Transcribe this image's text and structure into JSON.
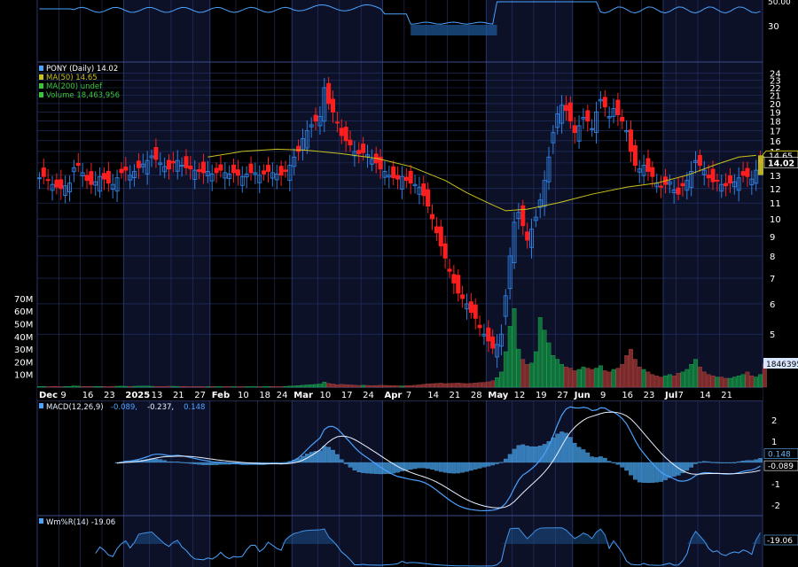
{
  "colors": {
    "background": "#000000",
    "month_band": "#0c1128",
    "grid": "#25356a",
    "up_candle": "#2f7fe0",
    "down_candle": "#ff1e1e",
    "ma50": "#c9c21e",
    "volume_up": "#11703a",
    "volume_down": "#7a2a2a",
    "macd_line": "#4aa3ff",
    "signal_line": "#e8f0ff",
    "histogram": "#3a8fd0",
    "willr_line": "#4aa3ff",
    "axis_text": "#ffffff",
    "label_price_box": "#c9c21e"
  },
  "chart_data": [
    {
      "panel": "rsi_top",
      "type": "line",
      "title": "",
      "y_ticks": [
        "30"
      ],
      "top_partial_label": "50.00",
      "ylim": [
        25,
        55
      ]
    },
    {
      "panel": "price",
      "type": "candlestick",
      "scale": "log",
      "legend": [
        {
          "label": "PONY (Daily) 14.02",
          "color": "#4aa3ff",
          "icon": "candle-icon"
        },
        {
          "label": "MA(50) 14.65",
          "color": "#c9c21e",
          "icon": "line-icon"
        },
        {
          "label": "MA(200) undef",
          "color": "#3ac43a",
          "icon": "line-icon"
        },
        {
          "label": "Volume 18,463,956",
          "color": "#3ac43a",
          "icon": "bar-icon"
        }
      ],
      "y_ticks": [
        "24",
        "23",
        "22",
        "21",
        "20",
        "19",
        "18",
        "17",
        "16",
        "15",
        "14",
        "13",
        "12",
        "11",
        "10",
        "9",
        "8",
        "7",
        "6",
        "5"
      ],
      "ylim": [
        4.5,
        25
      ],
      "last_close": "14.02",
      "ma50_value": "14.65",
      "ma50_points": [
        [
          39,
          14.5
        ],
        [
          47,
          15.0
        ],
        [
          55,
          15.2
        ],
        [
          62,
          15.1
        ],
        [
          70,
          14.8
        ],
        [
          78,
          14.4
        ],
        [
          86,
          13.7
        ],
        [
          94,
          12.6
        ],
        [
          99,
          11.7
        ],
        [
          104,
          11.0
        ],
        [
          108,
          10.5
        ],
        [
          113,
          10.6
        ],
        [
          120,
          11.0
        ],
        [
          128,
          11.6
        ],
        [
          136,
          12.1
        ],
        [
          143,
          12.4
        ],
        [
          150,
          13.0
        ],
        [
          157,
          13.9
        ],
        [
          162,
          14.5
        ],
        [
          166,
          14.65
        ]
      ],
      "price_closes": [
        12.8,
        12.9,
        12.6,
        12.3,
        12.1,
        12.0,
        12.2,
        12.4,
        13.6,
        13.8,
        13.2,
        12.6,
        12.3,
        12.5,
        12.9,
        12.7,
        12.4,
        12.3,
        12.8,
        13.2,
        13.4,
        13.0,
        13.3,
        13.6,
        13.9,
        14.2,
        14.6,
        14.3,
        14.0,
        13.7,
        13.5,
        14.0,
        14.2,
        13.8,
        13.6,
        13.5,
        13.4,
        13.3,
        13.2,
        13.3,
        13.1,
        13.2,
        13.4,
        13.2,
        13.1,
        13.2,
        13.0,
        12.9,
        13.1,
        13.2,
        13.2,
        13.0,
        13.1,
        13.3,
        13.2,
        13.1,
        13.0,
        13.3,
        13.8,
        14.5,
        15.0,
        16.2,
        17.0,
        17.6,
        18.0,
        18.5,
        22.0,
        20.0,
        19.0,
        17.8,
        16.5,
        16.0,
        15.6,
        15.0,
        14.8,
        14.9,
        14.7,
        14.3,
        14.0,
        13.5,
        13.3,
        13.0,
        12.8,
        12.7,
        12.9,
        12.6,
        12.4,
        12.3,
        12.1,
        11.5,
        10.8,
        10.0,
        9.2,
        8.5,
        7.9,
        7.3,
        6.8,
        6.4,
        6.2,
        6.0,
        5.7,
        5.5,
        5.2,
        5.0,
        4.8,
        4.6,
        4.7,
        5.0,
        6.3,
        8.0,
        9.8,
        10.4,
        9.6,
        8.8,
        9.4,
        10.1,
        11.2,
        12.6,
        14.5,
        16.8,
        18.8,
        19.8,
        19.2,
        18.0,
        16.8,
        17.5,
        18.4,
        18.0,
        17.2,
        19.0,
        20.5,
        19.6,
        18.5,
        19.4,
        18.7,
        18.0,
        17.0,
        15.0,
        13.8,
        13.5,
        13.8,
        13.3,
        12.9,
        12.4,
        12.1,
        12.3,
        12.5,
        11.9,
        11.6,
        12.2,
        12.6,
        13.3,
        14.2,
        13.8,
        13.4,
        12.8,
        12.5,
        12.6,
        12.3,
        12.2,
        12.4,
        12.5,
        12.8,
        13.0,
        12.9,
        12.7,
        13.4,
        14.02
      ]
    },
    {
      "panel": "volume",
      "type": "bar",
      "y_ticks": [
        "70M",
        "60M",
        "50M",
        "40M",
        "30M",
        "20M",
        "10M"
      ],
      "last_volume_label": "1846395",
      "volumes_m": [
        0.5,
        0.6,
        0.4,
        0.5,
        0.6,
        0.4,
        0.5,
        0.6,
        1.0,
        0.8,
        0.6,
        0.5,
        0.5,
        0.6,
        0.5,
        0.5,
        0.4,
        0.6,
        0.7,
        0.8,
        0.7,
        0.6,
        0.7,
        0.8,
        0.8,
        0.9,
        0.7,
        0.6,
        0.6,
        0.5,
        0.7,
        0.7,
        0.6,
        0.5,
        0.5,
        0.4,
        0.5,
        0.5,
        0.4,
        0.4,
        0.5,
        0.4,
        0.4,
        0.4,
        0.4,
        0.4,
        0.4,
        0.4,
        0.4,
        0.4,
        0.4,
        0.4,
        0.4,
        0.5,
        0.5,
        0.4,
        0.4,
        0.5,
        0.8,
        1.0,
        1.2,
        1.5,
        1.8,
        2.0,
        2.2,
        2.5,
        4.0,
        3.0,
        2.5,
        2.0,
        2.2,
        2.0,
        1.8,
        1.5,
        1.4,
        1.5,
        1.4,
        1.2,
        1.3,
        1.5,
        1.4,
        1.3,
        1.2,
        1.1,
        1.0,
        1.2,
        1.3,
        1.5,
        1.8,
        2.2,
        2.6,
        2.8,
        3.0,
        3.2,
        2.8,
        3.0,
        3.1,
        3.3,
        3.0,
        2.8,
        3.0,
        3.3,
        3.6,
        3.8,
        4.2,
        5.0,
        7.5,
        12.0,
        28.0,
        48.0,
        62.0,
        30.0,
        22.0,
        18.0,
        19.0,
        28.0,
        55.0,
        45.0,
        35.0,
        25.0,
        22.0,
        18.0,
        16.0,
        15.0,
        13.0,
        14.0,
        16.0,
        15.0,
        14.0,
        15.0,
        17.0,
        13.0,
        12.0,
        14.0,
        15.0,
        18.0,
        25.0,
        30.0,
        22.0,
        16.0,
        14.0,
        12.0,
        10.0,
        9.0,
        8.0,
        9.0,
        10.0,
        9.0,
        11.0,
        12.0,
        14.0,
        18.0,
        22.0,
        16.0,
        12.0,
        10.0,
        9.0,
        8.0,
        8.0,
        7.0,
        7.0,
        8.0,
        9.0,
        10.0,
        12.0,
        9.0,
        8.0,
        10.0,
        18.46
      ]
    },
    {
      "panel": "macd",
      "type": "line",
      "legend": [
        {
          "label": "MACD(12,26,9)",
          "color": "#e8f0ff"
        },
        {
          "label": "-0.089,",
          "color": "#4aa3ff"
        },
        {
          "label": "-0.237,",
          "color": "#e8f0ff"
        },
        {
          "label": "0.148",
          "color": "#4aa3ff"
        }
      ],
      "y_ticks": [
        "2",
        "1",
        "-1",
        "-2"
      ],
      "ylim": [
        -2.6,
        2.6
      ],
      "value_labels": [
        "0.148",
        "-0.089"
      ]
    },
    {
      "panel": "williams",
      "type": "line",
      "legend": "Wm%R(14) -19.06",
      "value_label": "-19.06"
    }
  ],
  "x_axis": {
    "labels": [
      {
        "text": "Dec",
        "bold": true,
        "idx": 0
      },
      {
        "text": "9",
        "bold": false,
        "idx": 5
      },
      {
        "text": "16",
        "bold": false,
        "idx": 10
      },
      {
        "text": "23",
        "bold": false,
        "idx": 15
      },
      {
        "text": "2025",
        "bold": true,
        "idx": 20
      },
      {
        "text": "13",
        "bold": false,
        "idx": 26
      },
      {
        "text": "21",
        "bold": false,
        "idx": 31
      },
      {
        "text": "27",
        "bold": false,
        "idx": 36
      },
      {
        "text": "Feb",
        "bold": true,
        "idx": 40
      },
      {
        "text": "10",
        "bold": false,
        "idx": 46
      },
      {
        "text": "18",
        "bold": false,
        "idx": 51
      },
      {
        "text": "24",
        "bold": false,
        "idx": 55
      },
      {
        "text": "Mar",
        "bold": true,
        "idx": 59
      },
      {
        "text": "10",
        "bold": false,
        "idx": 65
      },
      {
        "text": "17",
        "bold": false,
        "idx": 70
      },
      {
        "text": "24",
        "bold": false,
        "idx": 75
      },
      {
        "text": "Apr",
        "bold": true,
        "idx": 80
      },
      {
        "text": "7",
        "bold": false,
        "idx": 85
      },
      {
        "text": "14",
        "bold": false,
        "idx": 90
      },
      {
        "text": "21",
        "bold": false,
        "idx": 95
      },
      {
        "text": "28",
        "bold": false,
        "idx": 100
      },
      {
        "text": "May",
        "bold": true,
        "idx": 104
      },
      {
        "text": "12",
        "bold": false,
        "idx": 110
      },
      {
        "text": "19",
        "bold": false,
        "idx": 115
      },
      {
        "text": "27",
        "bold": false,
        "idx": 120
      },
      {
        "text": "Jun",
        "bold": true,
        "idx": 124
      },
      {
        "text": "9",
        "bold": false,
        "idx": 130
      },
      {
        "text": "16",
        "bold": false,
        "idx": 135
      },
      {
        "text": "23",
        "bold": false,
        "idx": 140
      },
      {
        "text": "Jul",
        "bold": true,
        "idx": 145
      },
      {
        "text": "7",
        "bold": false,
        "idx": 148
      },
      {
        "text": "14",
        "bold": false,
        "idx": 153
      },
      {
        "text": "21",
        "bold": false,
        "idx": 158
      }
    ]
  }
}
